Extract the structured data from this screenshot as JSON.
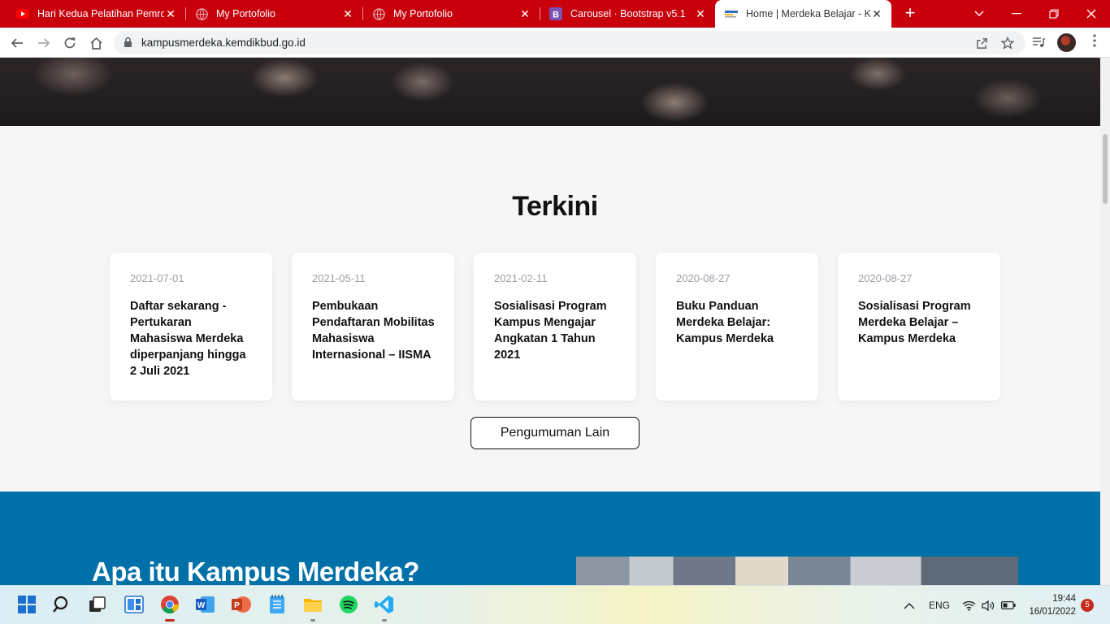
{
  "browser": {
    "tabs": [
      {
        "title": "Hari Kedua Pelatihan Pemrograman",
        "icon": "youtube-icon",
        "active": false
      },
      {
        "title": "My Portofolio",
        "icon": "globe-icon",
        "active": false
      },
      {
        "title": "My Portofolio",
        "icon": "globe-icon",
        "active": false
      },
      {
        "title": "Carousel · Bootstrap v5.1",
        "icon": "bootstrap-icon",
        "active": false
      },
      {
        "title": "Home | Merdeka Belajar - Kampus Merdeka",
        "icon": "kampus-merdeka-icon",
        "active": true
      }
    ],
    "new_tab": "+",
    "close_glyph": "✕",
    "url": "kampusmerdeka.kemdikbud.go.id",
    "colors": {
      "tabbar": "#c7000b",
      "accent_blue": "#0070a8"
    }
  },
  "page": {
    "section_title": "Terkini",
    "news": [
      {
        "date": "2021-07-01",
        "title": "Daftar sekarang - Pertukaran Mahasiswa Merdeka diperpanjang hingga 2 Juli 2021"
      },
      {
        "date": "2021-05-11",
        "title": "Pembukaan Pendaftaran Mobilitas Mahasiswa Internasional – IISMA"
      },
      {
        "date": "2021-02-11",
        "title": "Sosialisasi Program Kampus Mengajar Angkatan 1 Tahun 2021"
      },
      {
        "date": "2020-08-27",
        "title": "Buku Panduan Merdeka Belajar: Kampus Merdeka"
      },
      {
        "date": "2020-08-27",
        "title": "Sosialisasi Program Merdeka Belajar – Kampus Merdeka"
      }
    ],
    "more_button": "Pengumuman Lain",
    "about_title": "Apa itu Kampus Merdeka?"
  },
  "taskbar": {
    "apps": [
      "windows-start-icon",
      "search-icon",
      "task-view-icon",
      "widgets-icon",
      "chrome-icon",
      "word-icon",
      "powerpoint-icon",
      "notepad-icon",
      "file-explorer-icon",
      "spotify-icon",
      "vscode-icon"
    ],
    "language": "ENG",
    "time": "19:44",
    "date": "16/01/2022",
    "notifications": "5"
  }
}
